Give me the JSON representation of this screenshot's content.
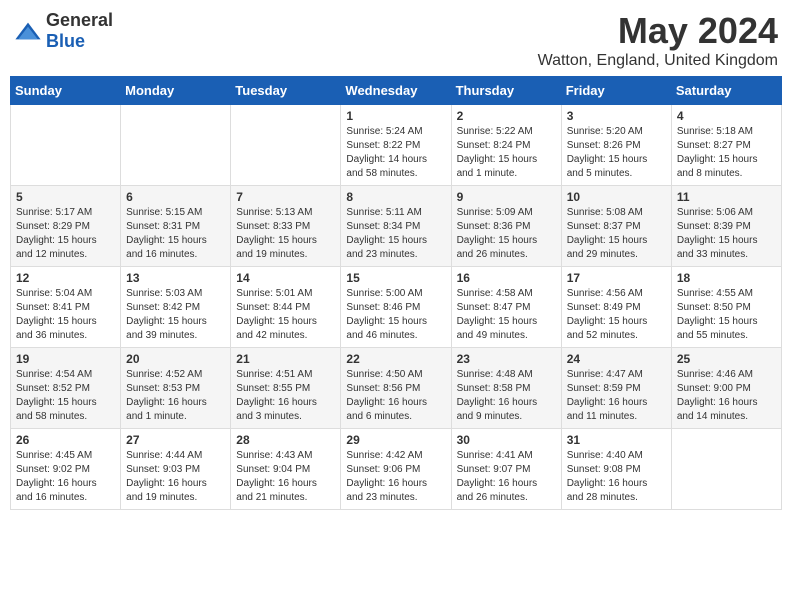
{
  "header": {
    "logo_general": "General",
    "logo_blue": "Blue",
    "main_title": "May 2024",
    "subtitle": "Watton, England, United Kingdom"
  },
  "weekdays": [
    "Sunday",
    "Monday",
    "Tuesday",
    "Wednesday",
    "Thursday",
    "Friday",
    "Saturday"
  ],
  "weeks": [
    [
      {
        "day": "",
        "info": ""
      },
      {
        "day": "",
        "info": ""
      },
      {
        "day": "",
        "info": ""
      },
      {
        "day": "1",
        "info": "Sunrise: 5:24 AM\nSunset: 8:22 PM\nDaylight: 14 hours and 58 minutes."
      },
      {
        "day": "2",
        "info": "Sunrise: 5:22 AM\nSunset: 8:24 PM\nDaylight: 15 hours and 1 minute."
      },
      {
        "day": "3",
        "info": "Sunrise: 5:20 AM\nSunset: 8:26 PM\nDaylight: 15 hours and 5 minutes."
      },
      {
        "day": "4",
        "info": "Sunrise: 5:18 AM\nSunset: 8:27 PM\nDaylight: 15 hours and 8 minutes."
      }
    ],
    [
      {
        "day": "5",
        "info": "Sunrise: 5:17 AM\nSunset: 8:29 PM\nDaylight: 15 hours and 12 minutes."
      },
      {
        "day": "6",
        "info": "Sunrise: 5:15 AM\nSunset: 8:31 PM\nDaylight: 15 hours and 16 minutes."
      },
      {
        "day": "7",
        "info": "Sunrise: 5:13 AM\nSunset: 8:33 PM\nDaylight: 15 hours and 19 minutes."
      },
      {
        "day": "8",
        "info": "Sunrise: 5:11 AM\nSunset: 8:34 PM\nDaylight: 15 hours and 23 minutes."
      },
      {
        "day": "9",
        "info": "Sunrise: 5:09 AM\nSunset: 8:36 PM\nDaylight: 15 hours and 26 minutes."
      },
      {
        "day": "10",
        "info": "Sunrise: 5:08 AM\nSunset: 8:37 PM\nDaylight: 15 hours and 29 minutes."
      },
      {
        "day": "11",
        "info": "Sunrise: 5:06 AM\nSunset: 8:39 PM\nDaylight: 15 hours and 33 minutes."
      }
    ],
    [
      {
        "day": "12",
        "info": "Sunrise: 5:04 AM\nSunset: 8:41 PM\nDaylight: 15 hours and 36 minutes."
      },
      {
        "day": "13",
        "info": "Sunrise: 5:03 AM\nSunset: 8:42 PM\nDaylight: 15 hours and 39 minutes."
      },
      {
        "day": "14",
        "info": "Sunrise: 5:01 AM\nSunset: 8:44 PM\nDaylight: 15 hours and 42 minutes."
      },
      {
        "day": "15",
        "info": "Sunrise: 5:00 AM\nSunset: 8:46 PM\nDaylight: 15 hours and 46 minutes."
      },
      {
        "day": "16",
        "info": "Sunrise: 4:58 AM\nSunset: 8:47 PM\nDaylight: 15 hours and 49 minutes."
      },
      {
        "day": "17",
        "info": "Sunrise: 4:56 AM\nSunset: 8:49 PM\nDaylight: 15 hours and 52 minutes."
      },
      {
        "day": "18",
        "info": "Sunrise: 4:55 AM\nSunset: 8:50 PM\nDaylight: 15 hours and 55 minutes."
      }
    ],
    [
      {
        "day": "19",
        "info": "Sunrise: 4:54 AM\nSunset: 8:52 PM\nDaylight: 15 hours and 58 minutes."
      },
      {
        "day": "20",
        "info": "Sunrise: 4:52 AM\nSunset: 8:53 PM\nDaylight: 16 hours and 1 minute."
      },
      {
        "day": "21",
        "info": "Sunrise: 4:51 AM\nSunset: 8:55 PM\nDaylight: 16 hours and 3 minutes."
      },
      {
        "day": "22",
        "info": "Sunrise: 4:50 AM\nSunset: 8:56 PM\nDaylight: 16 hours and 6 minutes."
      },
      {
        "day": "23",
        "info": "Sunrise: 4:48 AM\nSunset: 8:58 PM\nDaylight: 16 hours and 9 minutes."
      },
      {
        "day": "24",
        "info": "Sunrise: 4:47 AM\nSunset: 8:59 PM\nDaylight: 16 hours and 11 minutes."
      },
      {
        "day": "25",
        "info": "Sunrise: 4:46 AM\nSunset: 9:00 PM\nDaylight: 16 hours and 14 minutes."
      }
    ],
    [
      {
        "day": "26",
        "info": "Sunrise: 4:45 AM\nSunset: 9:02 PM\nDaylight: 16 hours and 16 minutes."
      },
      {
        "day": "27",
        "info": "Sunrise: 4:44 AM\nSunset: 9:03 PM\nDaylight: 16 hours and 19 minutes."
      },
      {
        "day": "28",
        "info": "Sunrise: 4:43 AM\nSunset: 9:04 PM\nDaylight: 16 hours and 21 minutes."
      },
      {
        "day": "29",
        "info": "Sunrise: 4:42 AM\nSunset: 9:06 PM\nDaylight: 16 hours and 23 minutes."
      },
      {
        "day": "30",
        "info": "Sunrise: 4:41 AM\nSunset: 9:07 PM\nDaylight: 16 hours and 26 minutes."
      },
      {
        "day": "31",
        "info": "Sunrise: 4:40 AM\nSunset: 9:08 PM\nDaylight: 16 hours and 28 minutes."
      },
      {
        "day": "",
        "info": ""
      }
    ]
  ]
}
